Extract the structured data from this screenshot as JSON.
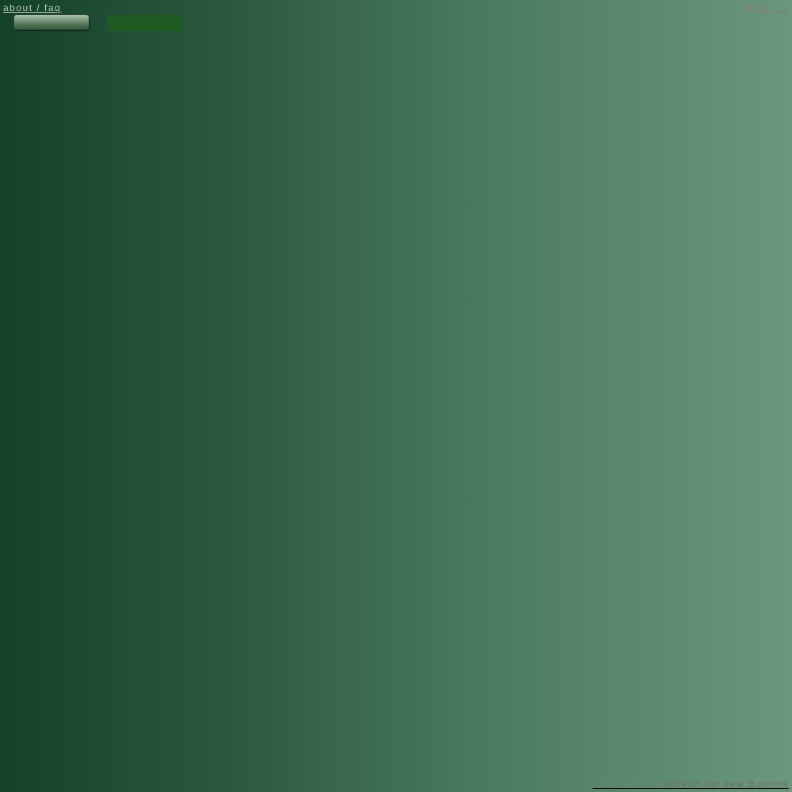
{
  "header": {
    "about_label": "about / faq",
    "drop_label": "drop: ..."
  },
  "buttons": [
    {
      "label": ""
    },
    {
      "label": ""
    }
  ],
  "footer": {
    "refresh_part1": "click here",
    "refresh_part2": " or ",
    "refresh_part3": "refresh for new Buttons"
  },
  "colors": {
    "bg_left": "#15412a",
    "bg_right": "#6b977c",
    "button_1": "#7e9c82",
    "button_2": "#1f5a22"
  }
}
